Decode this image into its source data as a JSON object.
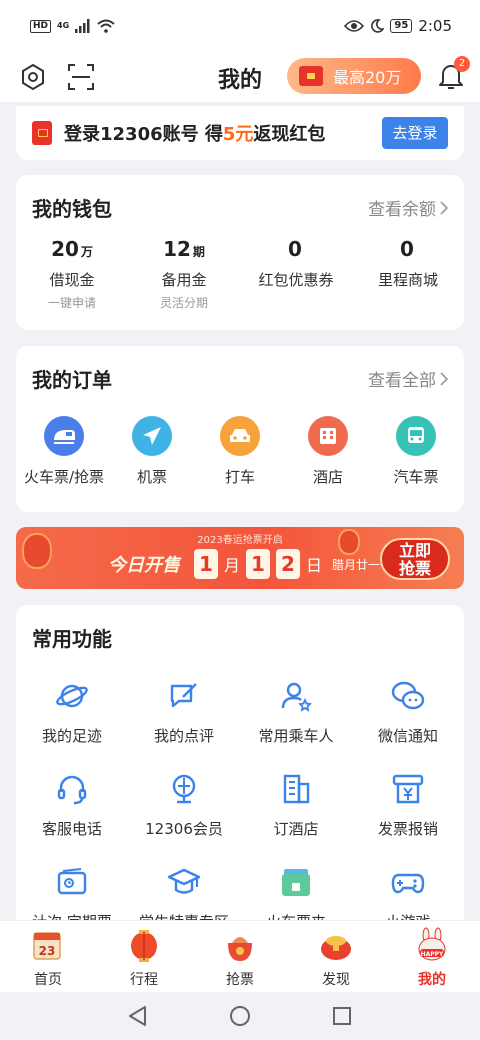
{
  "status_bar": {
    "hd": "HD",
    "network": "4G",
    "battery": "95",
    "time": "2:05"
  },
  "header": {
    "title": "我的",
    "promo_label": "最高20万",
    "notification_count": "2"
  },
  "login_banner": {
    "text_pre": "登录12306账号 得",
    "text_highlight": "5元",
    "text_post": "返现红包",
    "button": "去登录"
  },
  "wallet": {
    "title": "我的钱包",
    "link": "查看余额",
    "items": [
      {
        "value": "20",
        "unit": "万",
        "label": "借现金",
        "sub": "一键申请"
      },
      {
        "value": "12",
        "unit": "期",
        "label": "备用金",
        "sub": "灵活分期"
      },
      {
        "value": "0",
        "unit": "",
        "label": "红包优惠券",
        "sub": ""
      },
      {
        "value": "0",
        "unit": "",
        "label": "里程商城",
        "sub": ""
      }
    ]
  },
  "orders": {
    "title": "我的订单",
    "link": "查看全部",
    "items": [
      {
        "label": "火车票/抢票",
        "icon": "train-icon",
        "color": "#4a7ee8"
      },
      {
        "label": "机票",
        "icon": "plane-icon",
        "color": "#3fb3e6"
      },
      {
        "label": "打车",
        "icon": "car-icon",
        "color": "#f5a33a"
      },
      {
        "label": "酒店",
        "icon": "hotel-icon",
        "color": "#f06a4e"
      },
      {
        "label": "汽车票",
        "icon": "bus-icon",
        "color": "#36c2b4"
      }
    ]
  },
  "spring_banner": {
    "top_text": "2023春运抢票开启",
    "today": "今日开售",
    "month": "1",
    "month_unit": "月",
    "day_digit_1": "1",
    "day_digit_2": "2",
    "day_unit": "日",
    "lunar": "腊月廿一",
    "button_line1": "立即",
    "button_line2": "抢票"
  },
  "tools": {
    "title": "常用功能",
    "items": [
      {
        "label": "我的足迹",
        "icon": "planet-icon"
      },
      {
        "label": "我的点评",
        "icon": "comment-icon"
      },
      {
        "label": "常用乘车人",
        "icon": "passenger-icon"
      },
      {
        "label": "微信通知",
        "icon": "wechat-icon"
      },
      {
        "label": "客服电话",
        "icon": "headset-icon"
      },
      {
        "label": "12306会员",
        "icon": "member-icon"
      },
      {
        "label": "订酒店",
        "icon": "building-icon"
      },
      {
        "label": "发票报销",
        "icon": "invoice-icon"
      },
      {
        "label": "计次·定期票",
        "icon": "ticket-icon"
      },
      {
        "label": "学生特惠专区",
        "icon": "graduation-icon"
      },
      {
        "label": "火车票夹",
        "icon": "ticket-folder-icon"
      },
      {
        "label": "小游戏",
        "icon": "gamepad-icon"
      }
    ]
  },
  "tabbar": {
    "items": [
      {
        "label": "首页",
        "icon": "calendar-icon"
      },
      {
        "label": "行程",
        "icon": "lantern-icon"
      },
      {
        "label": "抢票",
        "icon": "bag-icon"
      },
      {
        "label": "发现",
        "icon": "treasure-icon"
      },
      {
        "label": "我的",
        "icon": "rabbit-icon",
        "active": true,
        "badge": "HAPPY"
      }
    ]
  },
  "colors": {
    "accent_blue": "#3b82e9",
    "accent_red": "#e8322a",
    "accent_orange": "#ff6a1a"
  }
}
